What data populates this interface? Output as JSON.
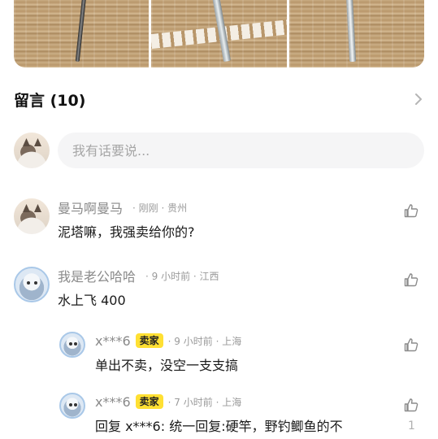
{
  "section": {
    "title": "留言 (10)"
  },
  "composer": {
    "placeholder": "我有话要说..."
  },
  "comments": [
    {
      "name": "曼马啊曼马",
      "time": "· 刚刚 · 贵州",
      "text": "泥塔嘛，我强卖给你的?"
    },
    {
      "name": "我是老公哈哈",
      "time": "· 9 小时前 · 江西",
      "text": "水上飞 400",
      "replies": [
        {
          "name": "x***6",
          "badge": "卖家",
          "time": "· 9 小时前 · 上海",
          "text": "单出不卖，没空一支支搞"
        },
        {
          "name": "x***6",
          "badge": "卖家",
          "time": "· 7 小时前 · 上海",
          "text": "回复 x***6: 统一回复:硬竿，野钓鲫鱼的不",
          "likes": "1"
        }
      ]
    }
  ],
  "icons": [
    "chevron-right-icon",
    "thumbs-up-icon"
  ],
  "colors": {
    "badge": "#ffe033",
    "meta": "#8a8a8a",
    "input_bg": "#f5f5f6"
  }
}
